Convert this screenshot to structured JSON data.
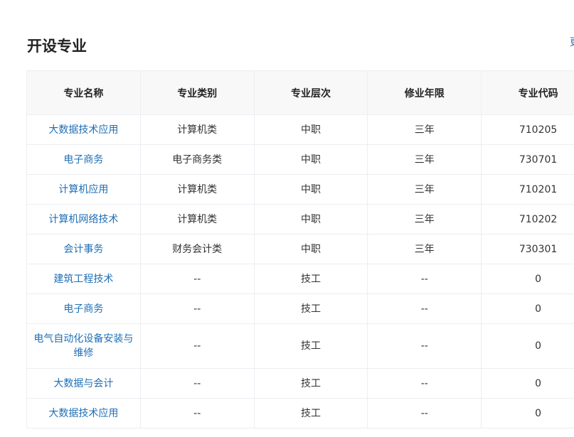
{
  "page": {
    "title": "开设专业",
    "more_label": "更"
  },
  "table": {
    "headers": [
      "专业名称",
      "专业类别",
      "专业层次",
      "修业年限",
      "专业代码"
    ],
    "rows": [
      {
        "name": "大数据技术应用",
        "category": "计算机类",
        "level": "中职",
        "years": "三年",
        "code": "710205"
      },
      {
        "name": "电子商务",
        "category": "电子商务类",
        "level": "中职",
        "years": "三年",
        "code": "730701"
      },
      {
        "name": "计算机应用",
        "category": "计算机类",
        "level": "中职",
        "years": "三年",
        "code": "710201"
      },
      {
        "name": "计算机网络技术",
        "category": "计算机类",
        "level": "中职",
        "years": "三年",
        "code": "710202"
      },
      {
        "name": "会计事务",
        "category": "财务会计类",
        "level": "中职",
        "years": "三年",
        "code": "730301"
      },
      {
        "name": "建筑工程技术",
        "category": "--",
        "level": "技工",
        "years": "--",
        "code": "0"
      },
      {
        "name": "电子商务",
        "category": "--",
        "level": "技工",
        "years": "--",
        "code": "0"
      },
      {
        "name": "电气自动化设备安装与维修",
        "category": "--",
        "level": "技工",
        "years": "--",
        "code": "0"
      },
      {
        "name": "大数据与会计",
        "category": "--",
        "level": "技工",
        "years": "--",
        "code": "0"
      },
      {
        "name": "大数据技术应用",
        "category": "--",
        "level": "技工",
        "years": "--",
        "code": "0"
      }
    ]
  },
  "colors": {
    "link": "#1f6fb5",
    "header_bg": "#f8f8f9",
    "border": "#ebeef2"
  }
}
